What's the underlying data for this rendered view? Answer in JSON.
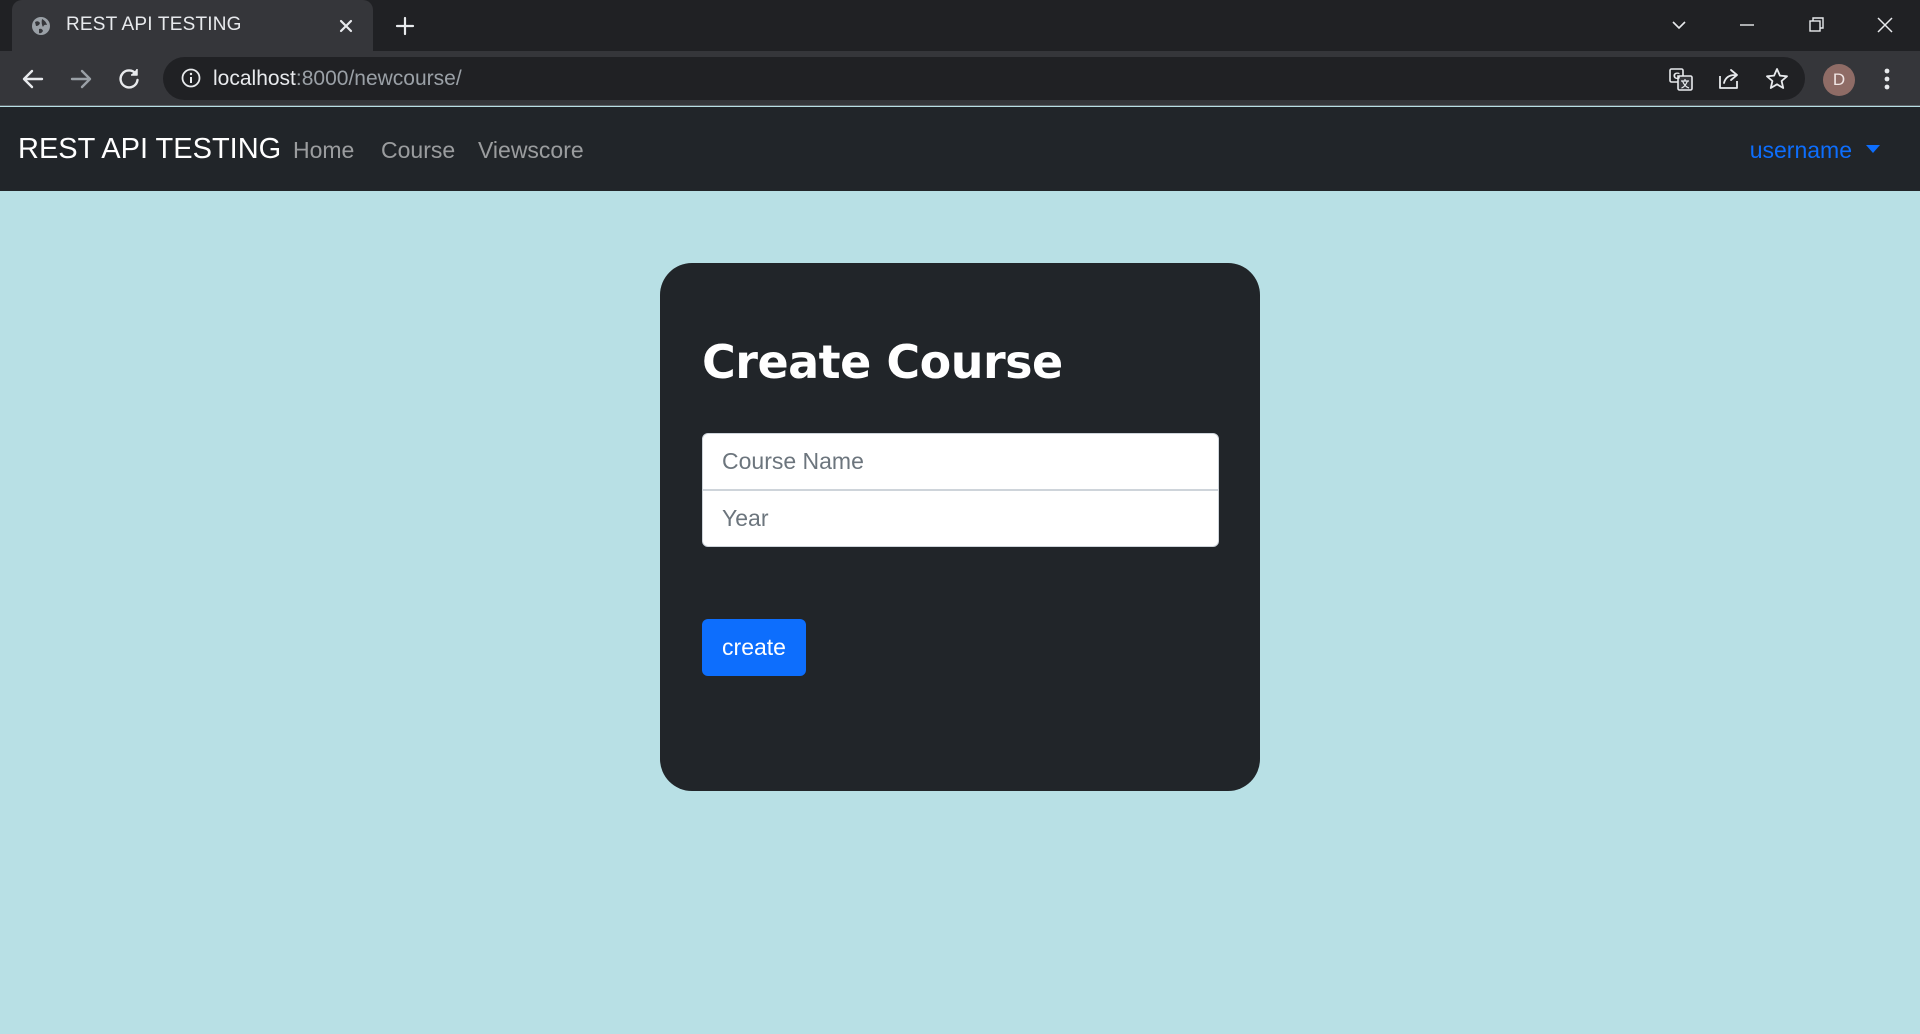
{
  "browser": {
    "tab_title": "REST API TESTING",
    "url_host": "localhost",
    "url_rest": ":8000/newcourse/",
    "profile_initial": "D",
    "icons": [
      "globe-icon",
      "close-icon",
      "plus-icon",
      "chevron-down-icon",
      "minimize-icon",
      "restore-icon",
      "close-window-icon",
      "back-icon",
      "forward-icon",
      "reload-icon",
      "info-icon",
      "translate-icon",
      "share-icon",
      "star-icon",
      "more-vert-icon"
    ]
  },
  "navbar": {
    "brand": "REST API TESTING",
    "links": [
      "Home",
      "Course",
      "Viewscore"
    ],
    "user": "username",
    "user_color": "#0d6efd"
  },
  "form": {
    "title": "Create Course",
    "course_name_placeholder": "Course Name",
    "course_name_value": "",
    "year_placeholder": "Year",
    "year_value": "",
    "submit_label": "create",
    "submit_color": "#0d6efd"
  },
  "colors": {
    "page_background": "#b8e0e5",
    "card_background": "#212529"
  }
}
